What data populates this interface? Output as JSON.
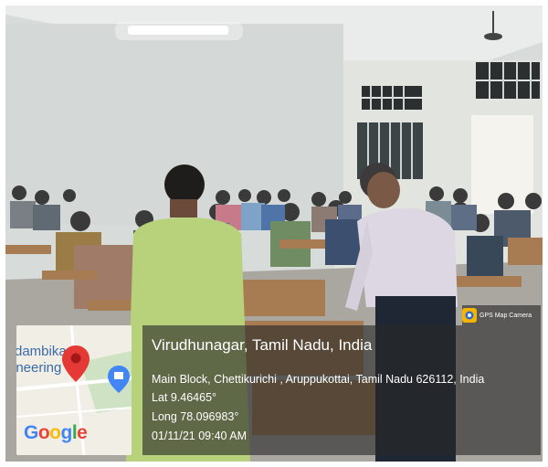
{
  "overlay": {
    "app_badge": "GPS Map Camera",
    "location_title": "Virudhunagar, Tamil Nadu, India",
    "address": "Main Block, Chettikurichi , Aruppukottai, Tamil Nadu 626112, India",
    "lat": "Lat 9.46465°",
    "long": "Long 78.096983°",
    "datetime": "01/11/21 09:40 AM",
    "map_label_line1": "dambika",
    "map_label_line2": "ineering",
    "map_provider": "Google"
  },
  "colors": {
    "overlay_bg": "#282828",
    "pin_red": "#e53935",
    "pin_blue": "#4285f4"
  }
}
